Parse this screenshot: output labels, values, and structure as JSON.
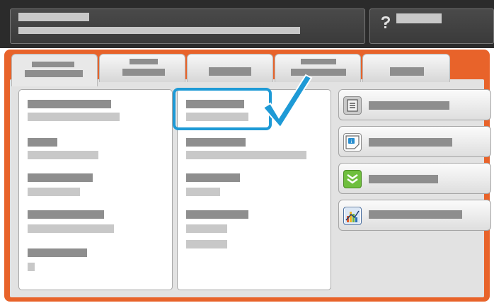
{
  "ui": {
    "tabs": [
      "",
      "",
      "",
      "",
      ""
    ],
    "side_buttons": [
      "",
      "",
      "",
      ""
    ]
  },
  "colors": {
    "accent": "#e8632a",
    "header": "#2b2b2b",
    "selection": "#1e9ad6",
    "placeholder_bar": "#8e8e8e"
  },
  "icons": [
    "help-icon",
    "document-list-icon",
    "info-note-icon",
    "download-arrows-icon",
    "bar-chart-icon",
    "checkmark-icon"
  ]
}
